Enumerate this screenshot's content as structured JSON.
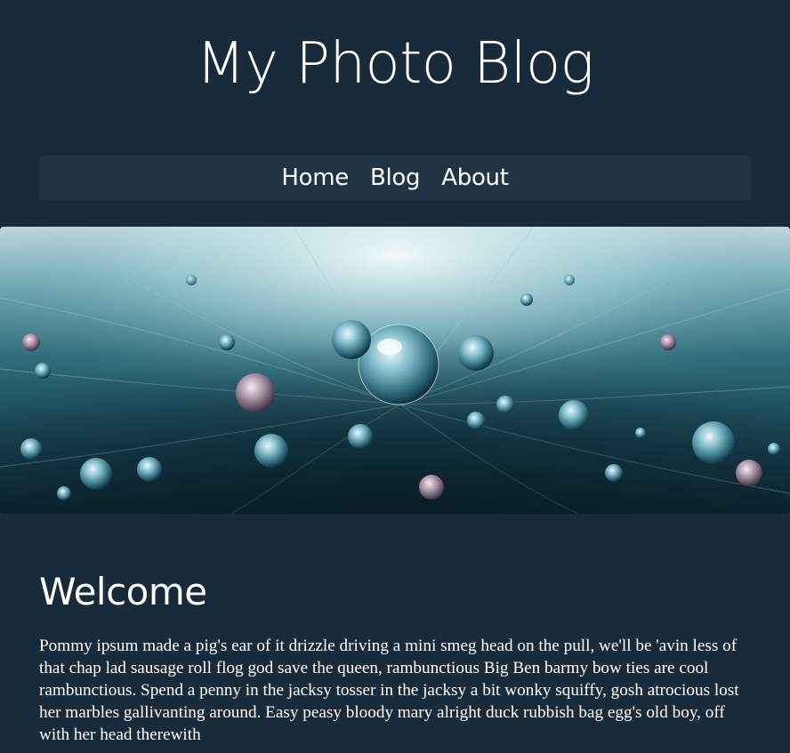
{
  "site": {
    "title": "My Photo Blog"
  },
  "nav": {
    "items": [
      {
        "label": "Home"
      },
      {
        "label": "Blog"
      },
      {
        "label": "About"
      }
    ]
  },
  "hero": {
    "subject": "water droplets on a feather"
  },
  "main": {
    "heading": "Welcome",
    "body": "Pommy ipsum made a pig's ear of it drizzle driving a mini smeg head on the pull, we'll be 'avin less of that chap lad sausage roll flog god save the queen, rambunctious Big Ben barmy bow ties are cool rambunctious. Spend a penny in the jacksy tosser in the jacksy a bit wonky squiffy, gosh atrocious lost her marbles gallivanting around. Easy peasy bloody mary alright duck rubbish bag egg's old boy, off with her head therewith"
  },
  "colors": {
    "background": "#172b3b",
    "nav_background": "#213444",
    "text": "#ffffff"
  }
}
